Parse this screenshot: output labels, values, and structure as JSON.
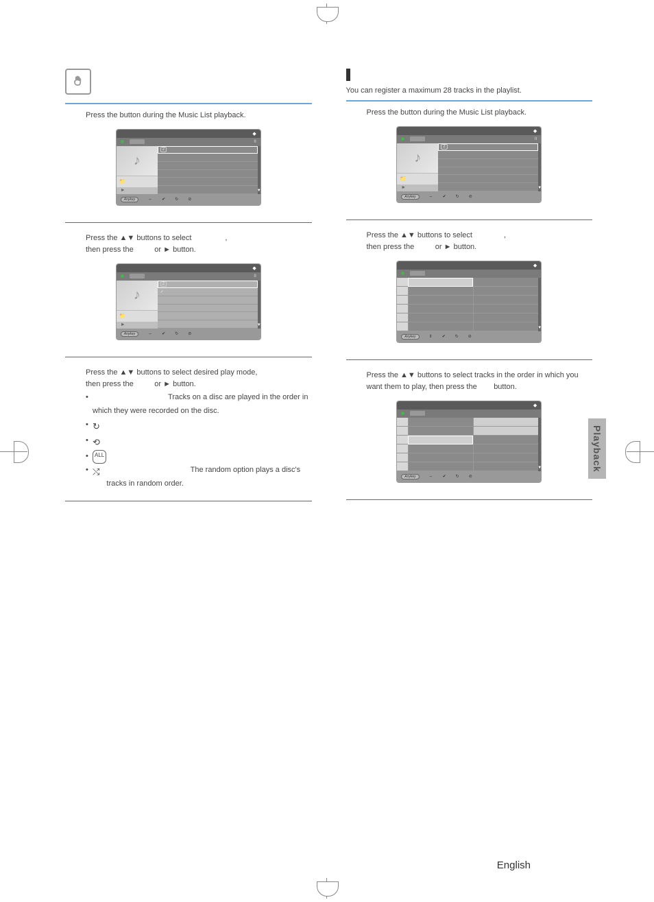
{
  "left": {
    "step1": {
      "pre": "Press the ",
      "post": " button during the Music List playback."
    },
    "step2": {
      "line1_pre": "Press the ",
      "line1_post": " buttons to select ",
      "line1_end": ",",
      "line2_pre": "then press the ",
      "line2_mid": " or ",
      "line2_post": " button."
    },
    "step3": {
      "line1_pre": "Press the ",
      "line1_mid": " buttons to select desired play mode,",
      "line2_pre": "then press the ",
      "line2_mid": " or ",
      "line2_post": " button."
    },
    "modes": {
      "normal_desc": "Tracks on a disc are played in the order in which they were recorded on the disc.",
      "random_desc": "The random option plays a disc's tracks in random order."
    }
  },
  "right": {
    "intro": "You can register a maximum 28 tracks in the playlist.",
    "step1": {
      "pre": "Press the ",
      "post": " button during the Music List playback."
    },
    "step2": {
      "line1_pre": "Press the ",
      "line1_post": " buttons to select ",
      "line1_end": ",",
      "line2_pre": "then press the ",
      "line2_mid": " or ",
      "line2_post": " button."
    },
    "step3": {
      "line1_pre": "Press the ",
      "line1_post": " buttons to select tracks in the order in which you want them to play, then press the ",
      "line1_end": " button."
    }
  },
  "screenshot": {
    "anykey": "Anykey",
    "scroll_arrow": "▼",
    "play_arrow": "►",
    "dot": "◆",
    "pause": "II",
    "badge_num": "2"
  },
  "glyphs": {
    "updown": "▲▼",
    "right": "►",
    "repeat_track": "↻",
    "repeat_list": "⟲",
    "repeat_all": "ALL",
    "random": "⤭"
  },
  "tab": "Playback",
  "footer": {
    "language": "English"
  }
}
